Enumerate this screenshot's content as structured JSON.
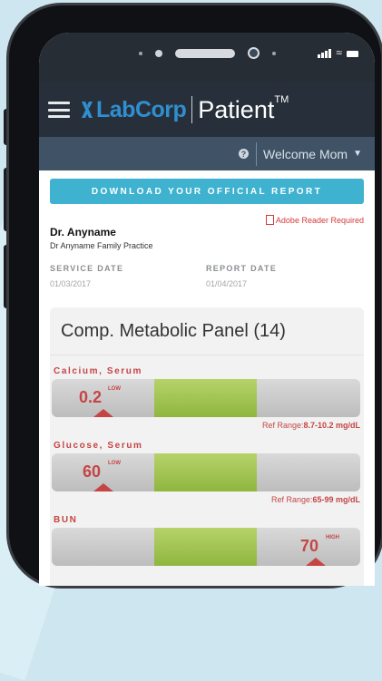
{
  "header": {
    "brand": "LabCorp",
    "app": "Patient",
    "trademark": "TM",
    "welcome": "Welcome",
    "user": "Mom"
  },
  "actions": {
    "download": "DOWNLOAD YOUR OFFICIAL REPORT",
    "adobe": "Adobe Reader Required"
  },
  "doctor": {
    "name": "Dr. Anyname",
    "practice": "Dr Anyname Family Practice"
  },
  "dates": {
    "service_label": "SERVICE DATE",
    "service": "01/03/2017",
    "report_label": "REPORT DATE",
    "report": "01/04/2017"
  },
  "panel": {
    "title": "Comp. Metabolic Panel (14)"
  },
  "tests": [
    {
      "name": "Calcium, Serum",
      "value": "0.2",
      "flag": "LOW",
      "ref_label": "Ref Range:",
      "ref": "8.7-10.2 mg/dL"
    },
    {
      "name": "Glucose, Serum",
      "value": "60",
      "flag": "LOW",
      "ref_label": "Ref Range:",
      "ref": "65-99 mg/dL"
    },
    {
      "name": "BUN",
      "value": "70",
      "flag": "HIGH"
    }
  ],
  "colors": {
    "accent": "#3eb2cf",
    "alert": "#c54545",
    "normal_range": "#9bc24b"
  }
}
